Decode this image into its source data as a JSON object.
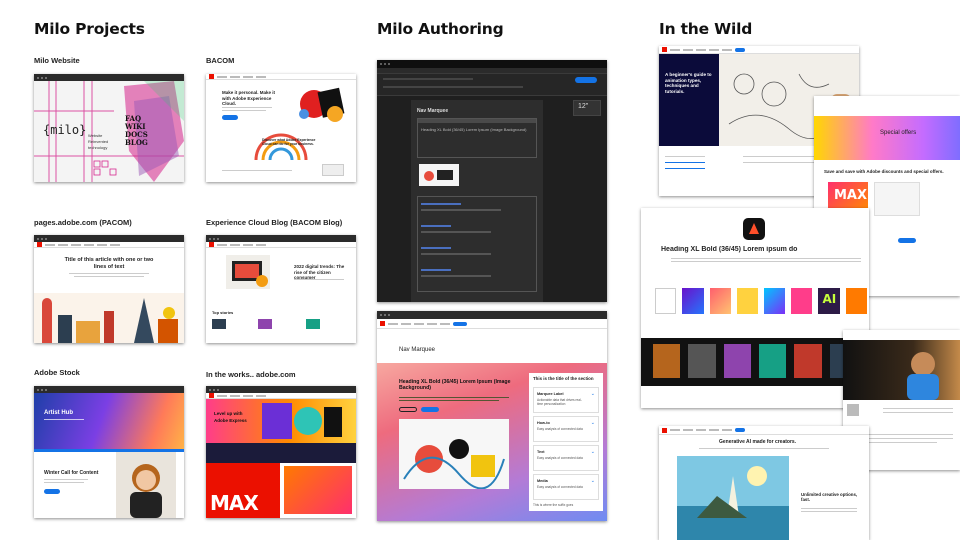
{
  "sections": {
    "milo_projects": "Milo Projects",
    "milo_authoring": "Milo Authoring",
    "in_the_wild": "In the Wild"
  },
  "captions": {
    "milo_website": "Milo Website",
    "bacom": "BACOM",
    "pacom": "pages.adobe.com (PACOM)",
    "ecblog": "Experience Cloud Blog (BACOM Blog)",
    "stock": "Adobe Stock",
    "works": "In the works.. adobe.com"
  },
  "milo": {
    "logo": "{milo}",
    "tag1": "Website",
    "tag2": "Reinvented",
    "tag3": "technology",
    "words": [
      "FAQ",
      "WIKI",
      "DOCS",
      "BLOG"
    ]
  },
  "bacom": {
    "title": "Make it personal. Make it with Adobe Experience Cloud.",
    "title2": "Discover what Adobe Experience Cloud can do for your business."
  },
  "pacom": {
    "title": "Title of this article with one or two lines of text"
  },
  "ecblog": {
    "title": "2022 digital trends: The rise of the citizen consumer",
    "stories": "Top stories"
  },
  "stock": {
    "hero": "Artist Hub",
    "card": "Winter Call for Content"
  },
  "works": {
    "hero": "Level up with Adobe Express",
    "promo": "MAX"
  },
  "authoring": {
    "doc_heading": "Nav Marquee",
    "doc_section": "Heading XL Bold (36/45) Lorem Ipsum (Image Background)",
    "preview_title": "Nav Marquee",
    "preview_heading": "Heading XL Bold (36/45) Lorem Ipsum (Image Background)",
    "preview_panel_title": "This is the title of the section",
    "accordion": [
      "Marquee Label",
      "How-to",
      "Text",
      "Media"
    ],
    "accordion_desc": [
      "Actionable data that drives real-time personalization",
      "Easy analysis of connected data",
      "Easy analysis of connected data",
      "Easy analysis of connected data"
    ],
    "footer": "This is where the suffix goes",
    "word_zoom": "12\""
  },
  "wild": {
    "guide": "A beginner's guide to animation types, techniques and tutorials.",
    "offers": "Special offers",
    "offers_sub": "Save and save with Adobe discounts and special offers.",
    "heading": "Heading XL Bold (36/45) Lorem ipsum do",
    "firefly": "Generative AI made for creators.",
    "firefly_sub": "Unlimited creative options, fast.",
    "max": "MAX",
    "ai": "AI"
  }
}
